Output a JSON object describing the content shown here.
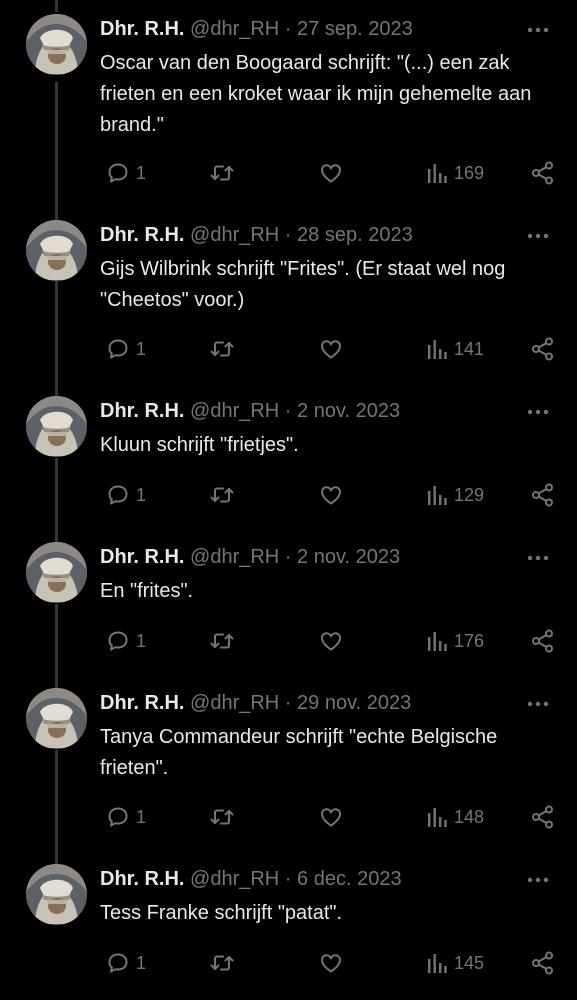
{
  "tweets": [
    {
      "name": "Dhr. R.H.",
      "handle": "@dhr_RH",
      "date": "27 sep. 2023",
      "text": "Oscar van den Boogaard schrijft: \"(...) een zak frieten en een kroket waar ik mijn gehemelte aan brand.\"",
      "replies": "1",
      "views": "169"
    },
    {
      "name": "Dhr. R.H.",
      "handle": "@dhr_RH",
      "date": "28 sep. 2023",
      "text": "Gijs Wilbrink schrijft \"Frites\". (Er staat wel nog \"Cheetos\" voor.)",
      "replies": "1",
      "views": "141"
    },
    {
      "name": "Dhr. R.H.",
      "handle": "@dhr_RH",
      "date": "2 nov. 2023",
      "text": "Kluun schrijft \"frietjes\".",
      "replies": "1",
      "views": "129"
    },
    {
      "name": "Dhr. R.H.",
      "handle": "@dhr_RH",
      "date": "2 nov. 2023",
      "text": "En \"frites\".",
      "replies": "1",
      "views": "176"
    },
    {
      "name": "Dhr. R.H.",
      "handle": "@dhr_RH",
      "date": "29 nov. 2023",
      "text": "Tanya Commandeur schrijft \"echte Belgische frieten\".",
      "replies": "1",
      "views": "148"
    },
    {
      "name": "Dhr. R.H.",
      "handle": "@dhr_RH",
      "date": "6 dec. 2023",
      "text": "Tess Franke schrijft \"patat\".",
      "replies": "1",
      "views": "145"
    }
  ],
  "separator": "·",
  "colors": {
    "background": "#000000",
    "text": "#e7e9ea",
    "muted": "#71767b",
    "thread_line": "#333639"
  },
  "icons": {
    "reply": "reply-icon",
    "retweet": "retweet-icon",
    "like": "heart-icon",
    "views": "views-icon",
    "share": "share-icon",
    "more": "more-icon"
  }
}
